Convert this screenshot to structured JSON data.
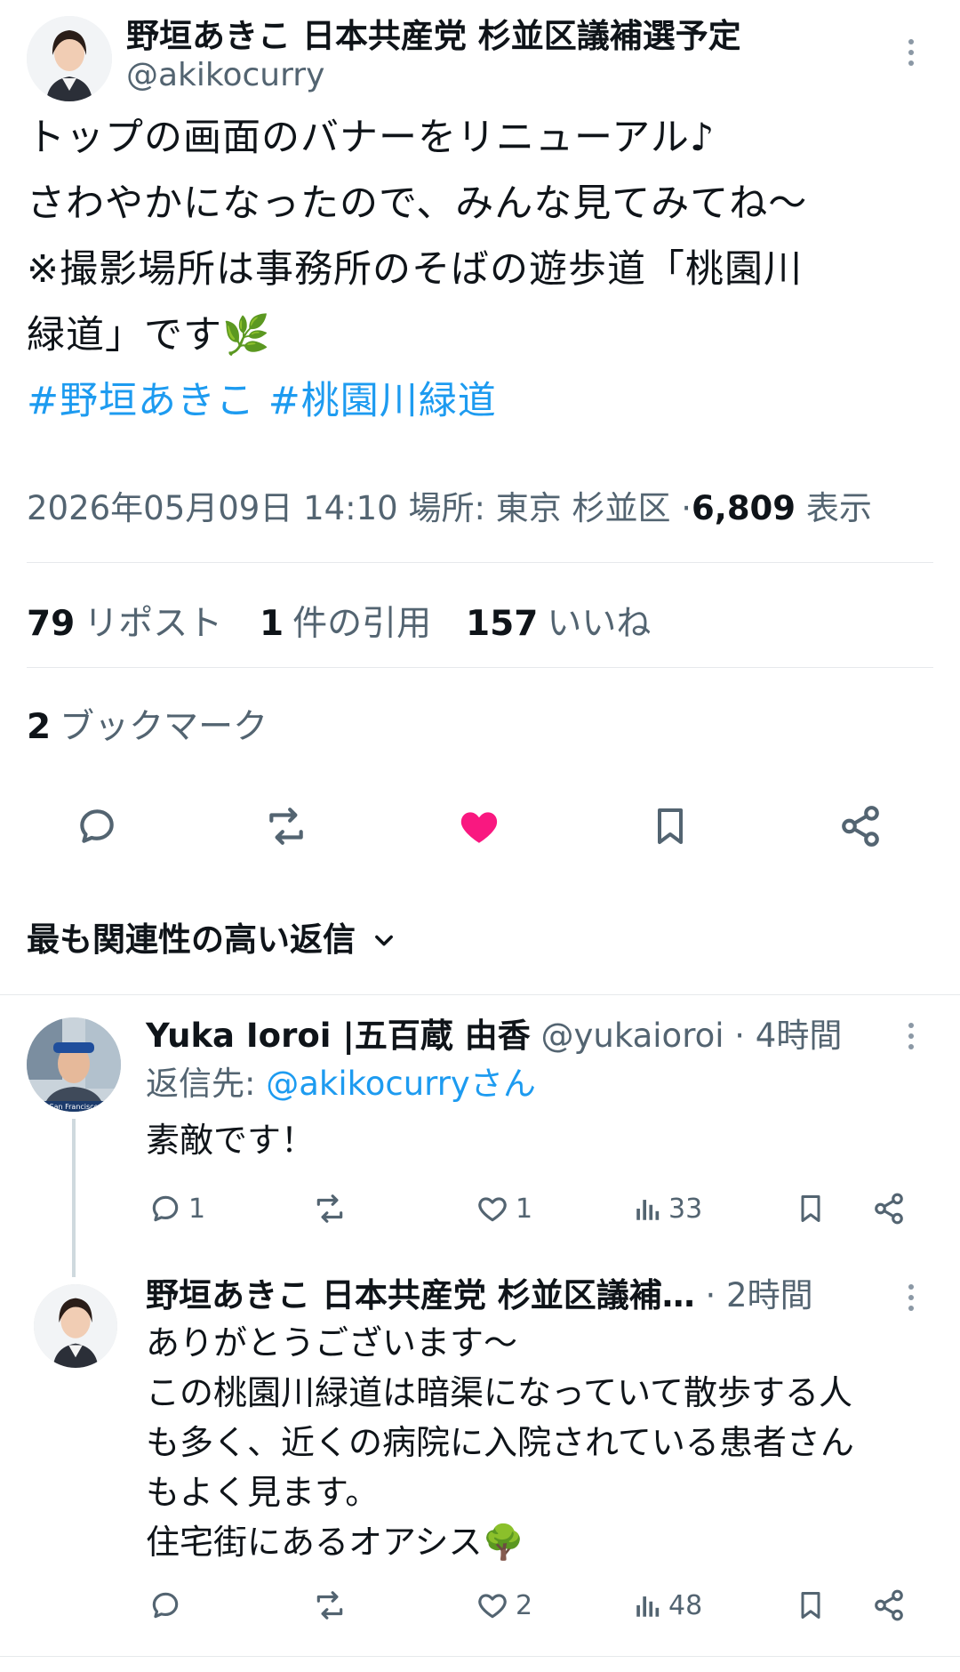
{
  "tweet": {
    "author_name": "野垣あきこ 日本共産党 杉並区議補選予定…",
    "handle": "@akikocurry",
    "text_lines": [
      "トップの画面のバナーをリニューアル♪",
      "さわやかになったので、みんな見てみてね〜",
      "※撮影場所は事務所のそばの遊歩道「桃園川",
      "緑道」です🌿"
    ],
    "hashtags": [
      "#野垣あきこ",
      "#桃園川緑道"
    ],
    "meta": {
      "datetime": "2026年05月09日 14:10",
      "location": "場所: 東京 杉並区",
      "separator": "·",
      "views_count": "6,809",
      "views_label": "表示"
    },
    "stats": {
      "reposts_count": "79",
      "reposts_label": "リポスト",
      "quotes_count": "1",
      "quotes_label": "件の引用",
      "likes_count": "157",
      "likes_label": "いいね",
      "bookmarks_count": "2",
      "bookmarks_label": "ブックマーク"
    },
    "liked": true
  },
  "sort": {
    "label": "最も関連性の高い返信"
  },
  "replies": [
    {
      "author_name": "Yuka Ioroi |五百蔵 由香",
      "handle": "@yukaioroi",
      "time": "· 4時間",
      "reply_to_prefix": "返信先: ",
      "reply_to": "@akikocurryさん",
      "text": "素敵です！",
      "avatar_caption": "San Francisco",
      "actions": {
        "replies": "1",
        "reposts": "",
        "likes": "1",
        "views": "33"
      }
    },
    {
      "author_name": "野垣あきこ 日本共産党 杉並区議補…",
      "time": "· 2時間",
      "text_lines": [
        "ありがとうございます〜",
        "この桃園川緑道は暗渠になっていて散歩する人",
        "も多く、近くの病院に入院されている患者さん",
        "もよく見ます。",
        "住宅街にあるオアシス🌳"
      ],
      "actions": {
        "replies": "",
        "reposts": "",
        "likes": "2",
        "views": "48"
      }
    }
  ],
  "colors": {
    "accent": "#1d9bf0",
    "like": "#f91880",
    "muted": "#536471",
    "text": "#0f1419"
  }
}
